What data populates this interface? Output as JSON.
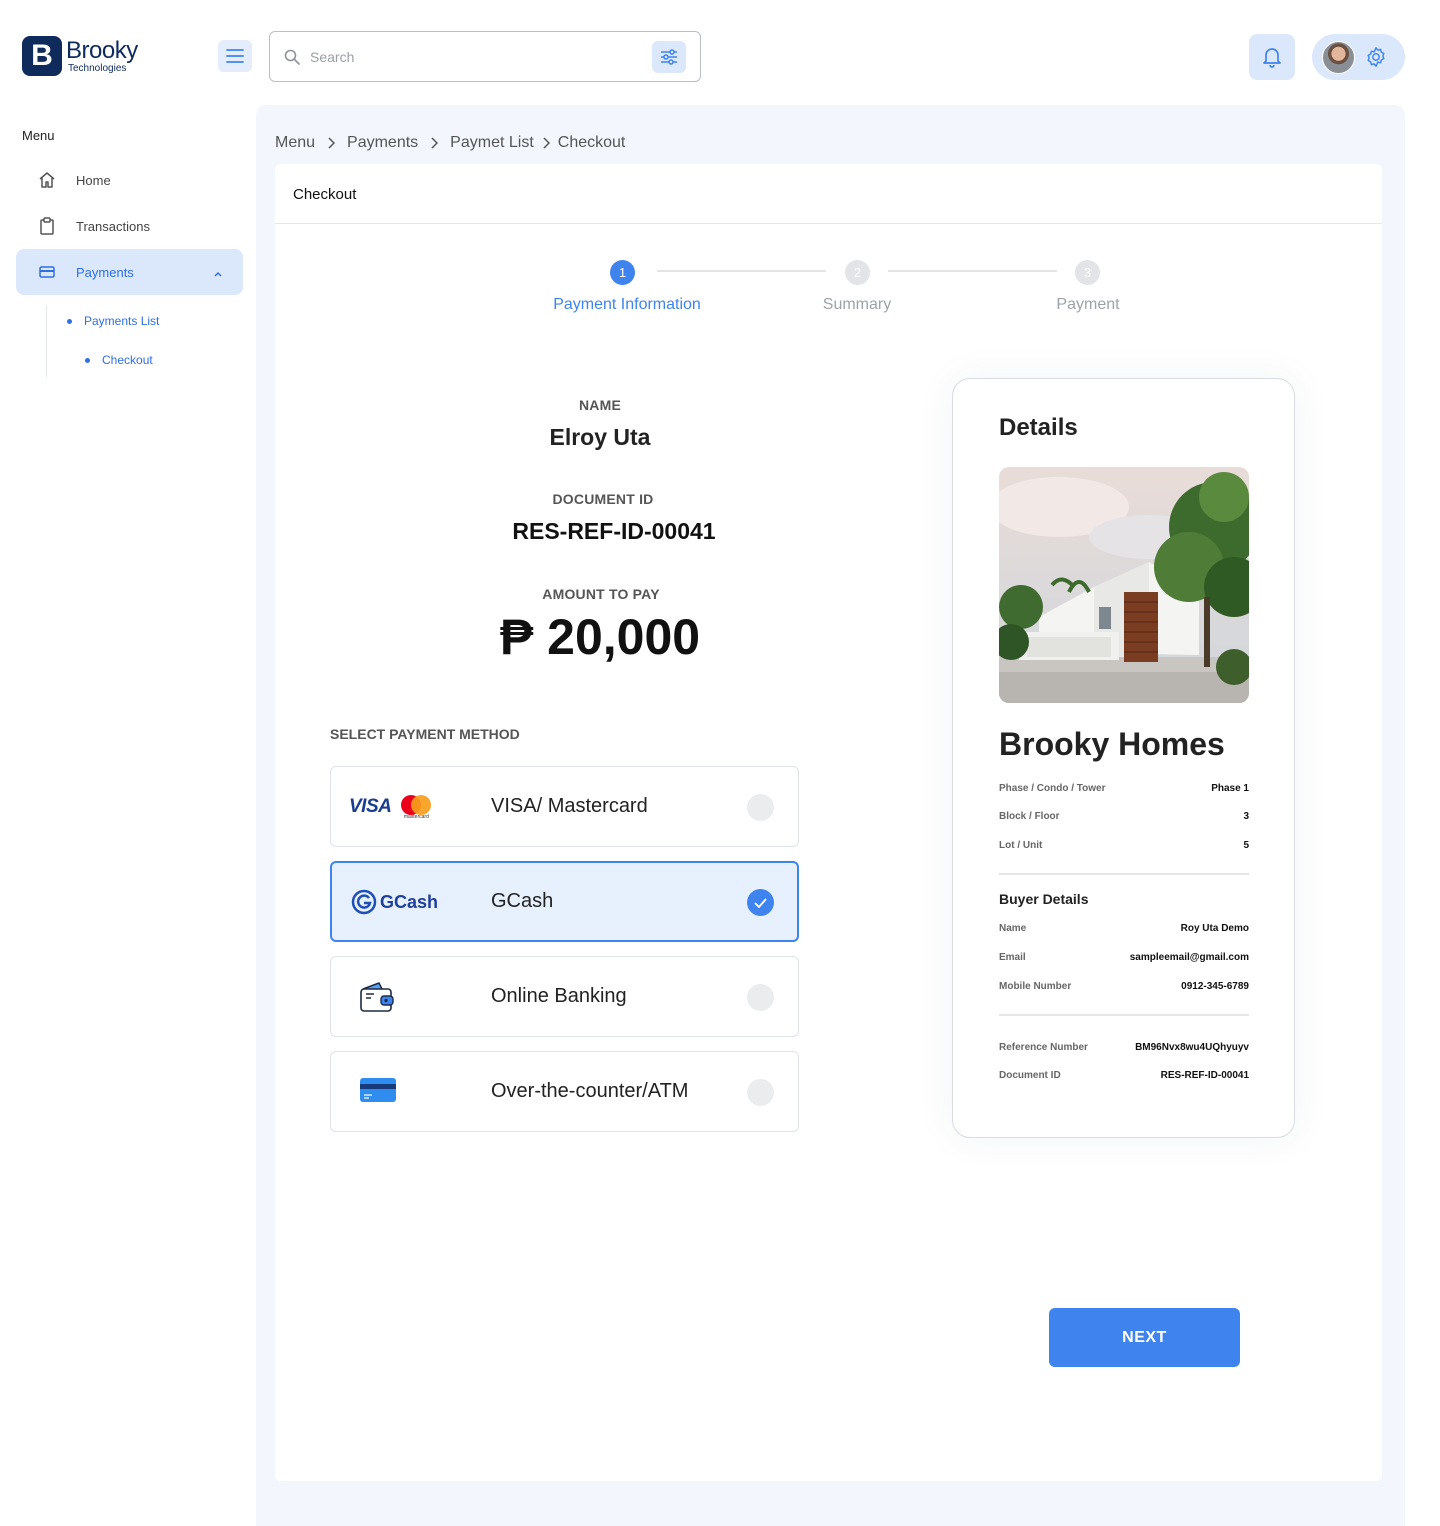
{
  "app": {
    "brand_name": "Brooky",
    "brand_sub": "Technologies",
    "brand_letter": "B"
  },
  "header": {
    "search_placeholder": "Search"
  },
  "sidebar": {
    "title": "Menu",
    "items": [
      {
        "label": "Home",
        "icon": "home-icon"
      },
      {
        "label": "Transactions",
        "icon": "clipboard-icon"
      },
      {
        "label": "Payments",
        "icon": "card-icon"
      }
    ],
    "sub_items": [
      {
        "label": "Payments List"
      },
      {
        "label": "Checkout"
      }
    ]
  },
  "breadcrumb": [
    "Menu",
    "Payments",
    "Paymet List",
    "Checkout"
  ],
  "card": {
    "title": "Checkout"
  },
  "stepper": [
    {
      "num": "1",
      "label": "Payment Information",
      "active": true
    },
    {
      "num": "2",
      "label": "Summary",
      "active": false
    },
    {
      "num": "3",
      "label": "Payment",
      "active": false
    }
  ],
  "payment_info": {
    "name_label": "NAME",
    "name": "Elroy Uta",
    "doc_label": "DOCUMENT ID",
    "doc_id": "RES-REF-ID-00041",
    "amount_label": "AMOUNT TO PAY",
    "amount": "₱ 20,000",
    "method_title": "SELECT PAYMENT METHOD"
  },
  "methods": [
    {
      "label": "VISA/ Mastercard",
      "selected": false,
      "visa": "VISA",
      "mc": "mastercard"
    },
    {
      "label": "GCash",
      "selected": true,
      "gcash": "GCash"
    },
    {
      "label": "Online Banking",
      "selected": false
    },
    {
      "label": "Over-the-counter/ATM",
      "selected": false
    }
  ],
  "details": {
    "title": "Details",
    "property_name": "Brooky Homes",
    "property_rows": [
      {
        "k": "Phase / Condo / Tower",
        "v": "Phase 1"
      },
      {
        "k": "Block / Floor",
        "v": "3"
      },
      {
        "k": "Lot / Unit",
        "v": "5"
      }
    ],
    "buyer_title": "Buyer Details",
    "buyer_rows": [
      {
        "k": "Name",
        "v": "Roy Uta Demo"
      },
      {
        "k": "Email",
        "v": "sampleemail@gmail.com"
      },
      {
        "k": "Mobile Number",
        "v": "0912-345-6789"
      }
    ],
    "ref_rows": [
      {
        "k": "Reference Number",
        "v": "BM96Nvx8wu4UQhyuyv"
      },
      {
        "k": "Document ID",
        "v": "RES-REF-ID-00041"
      }
    ]
  },
  "actions": {
    "next_label": "NEXT"
  },
  "colors": {
    "accent": "#3f84ee",
    "brand": "#0f2b5b",
    "light_accent": "#dbe8fb"
  }
}
